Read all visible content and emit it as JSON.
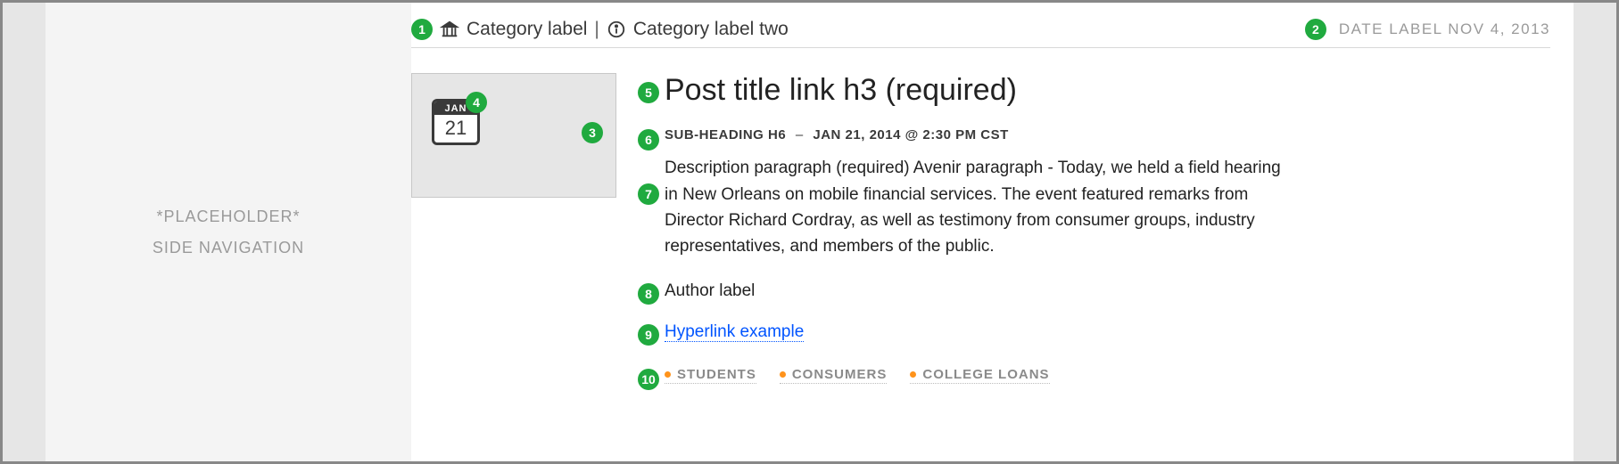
{
  "sidebar": {
    "line1": "*PLACEHOLDER*",
    "line2": "SIDE NAVIGATION"
  },
  "meta": {
    "category1": "Category label",
    "separator": "|",
    "category2": "Category label two",
    "date_label": "DATE LABEL NOV 4, 2013"
  },
  "thumb": {
    "cal_month": "JAN",
    "cal_day": "21"
  },
  "post": {
    "title": "Post title link h3 (required)",
    "subheading": "SUB-HEADING H6",
    "dash": "–",
    "event_time": "JAN 21, 2014 @ 2:30 PM CST",
    "description": "Description paragraph (required) Avenir paragraph - Today, we held a field hearing in New Orleans on mobile financial services. The event featured remarks from Director Richard Cordray, as well as testimony from consumer groups, industry representatives, and members of the public.",
    "author": "Author label",
    "hyperlink": "Hyperlink example",
    "tags": [
      "STUDENTS",
      "CONSUMERS",
      "COLLEGE LOANS"
    ]
  },
  "markers": {
    "m1": "1",
    "m2": "2",
    "m3": "3",
    "m4": "4",
    "m5": "5",
    "m6": "6",
    "m7": "7",
    "m8": "8",
    "m9": "9",
    "m10": "10"
  }
}
